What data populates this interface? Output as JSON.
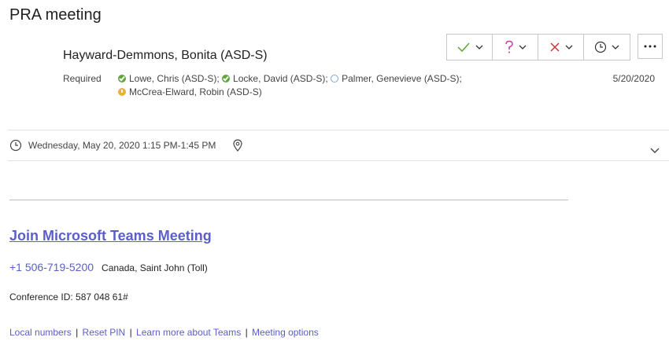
{
  "meeting": {
    "title": "PRA meeting",
    "sender": "Hayward-Demmons, Bonita (ASD-S)",
    "required_label": "Required",
    "attendees_line1": [
      {
        "name": "Lowe, Chris (ASD-S);",
        "status": "accepted"
      },
      {
        "name": "Locke, David (ASD-S);",
        "status": "accepted"
      },
      {
        "name": "Palmer, Genevieve (ASD-S);",
        "status": "none"
      }
    ],
    "attendees_line2": [
      {
        "name": "McCrea-Elward, Robin (ASD-S)",
        "status": "tentative"
      }
    ],
    "sent_date": "5/20/2020",
    "when": "Wednesday, May 20, 2020 1:15 PM-1:45 PM"
  },
  "colors": {
    "accept": "#5ea53a",
    "tentative": "#c239b3",
    "decline": "#d13438",
    "link": "#5b5fc7"
  },
  "body": {
    "join_label": "Join Microsoft Teams Meeting",
    "phone": "+1 506-719-5200",
    "phone_location": "Canada, Saint John (Toll)",
    "conference_id": "Conference ID: 587 048 61#",
    "links": {
      "local_numbers": "Local numbers",
      "reset_pin": "Reset PIN",
      "learn_more": "Learn more about Teams",
      "meeting_options": "Meeting options",
      "separator": "|"
    }
  }
}
